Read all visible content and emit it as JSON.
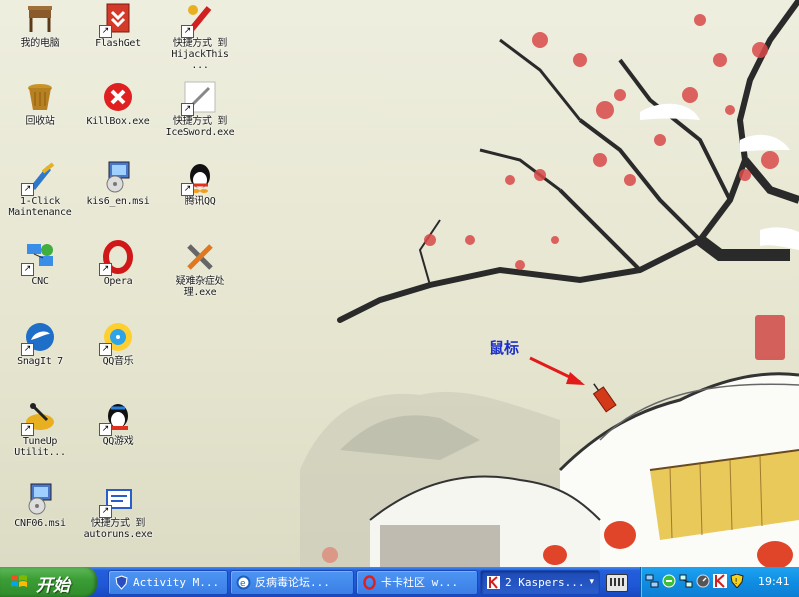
{
  "desktop": {
    "icons": [
      {
        "label": "我的电脑",
        "icon": "my-computer-icon",
        "shortcut": false
      },
      {
        "label": "FlashGet",
        "icon": "flashget-icon",
        "shortcut": true
      },
      {
        "label": "快捷方式 到\nHijackThis ...",
        "icon": "hijackthis-icon",
        "shortcut": true
      },
      {
        "label": "回收站",
        "icon": "recycle-bin-icon",
        "shortcut": false
      },
      {
        "label": "KillBox.exe",
        "icon": "killbox-icon",
        "shortcut": false
      },
      {
        "label": "快捷方式 到\nIceSword.exe",
        "icon": "icesword-icon",
        "shortcut": true
      },
      {
        "label": "1-Click\nMaintenance",
        "icon": "one-click-maintenance-icon",
        "shortcut": true
      },
      {
        "label": "kis6_en.msi",
        "icon": "msi-installer-icon",
        "shortcut": false
      },
      {
        "label": "腾讯QQ",
        "icon": "qq-icon",
        "shortcut": true
      },
      {
        "label": "CNC",
        "icon": "cnc-network-icon",
        "shortcut": true
      },
      {
        "label": "Opera",
        "icon": "opera-icon",
        "shortcut": true
      },
      {
        "label": "疑难杂症处\n理.exe",
        "icon": "tools-icon",
        "shortcut": false
      },
      {
        "label": "SnagIt 7",
        "icon": "snagit-icon",
        "shortcut": true
      },
      {
        "label": "QQ音乐",
        "icon": "qq-music-icon",
        "shortcut": true
      },
      {
        "label": "TuneUp\nUtilit...",
        "icon": "tuneup-icon",
        "shortcut": true
      },
      {
        "label": "QQ游戏",
        "icon": "qq-game-icon",
        "shortcut": true
      },
      {
        "label": "CNF06.msi",
        "icon": "msi-installer-icon",
        "shortcut": false
      },
      {
        "label": "快捷方式 到\nautoruns.exe",
        "icon": "autoruns-icon",
        "shortcut": true
      }
    ],
    "annotation": {
      "label": "鼠标",
      "arrow_color": "#e21a1a",
      "label_color": "#1b2fc9"
    }
  },
  "taskbar": {
    "start_label": "开始",
    "tasks": [
      {
        "label": "Activity M...",
        "icon": "shield-icon",
        "active": false
      },
      {
        "label": "反病毒论坛...",
        "icon": "ie-icon",
        "active": false
      },
      {
        "label": "卡卡社区 w...",
        "icon": "opera-icon",
        "active": false
      },
      {
        "label": "2 Kaspers...",
        "icon": "kaspersky-icon",
        "active": true,
        "group_count": "2",
        "dropdown": "▾"
      }
    ],
    "tray": {
      "icons": [
        "keyboard-icon",
        "network-icon",
        "green-circle-icon",
        "network-monitor-icon",
        "speed-icon",
        "kaspersky-k-icon",
        "shield-warning-icon"
      ],
      "clock": "19:41"
    }
  },
  "colors": {
    "taskbar": "#245edb",
    "start": "#3c9e36",
    "tray": "#0f8ee3"
  }
}
